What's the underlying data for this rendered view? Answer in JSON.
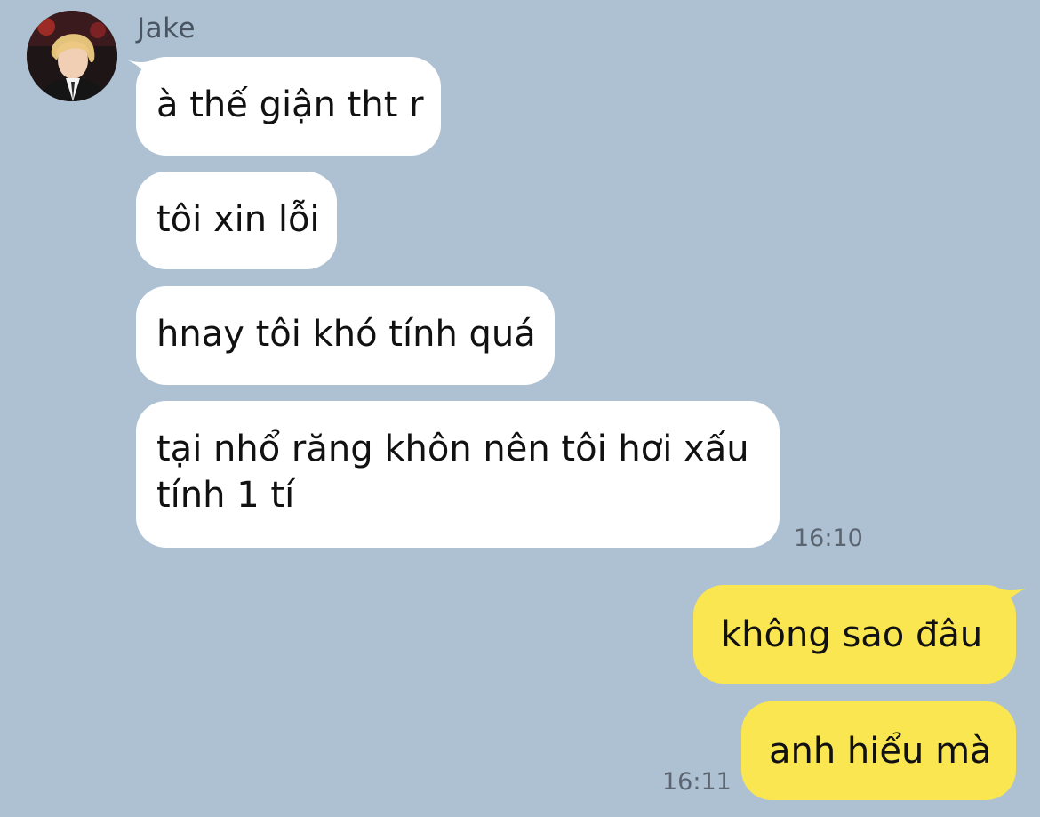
{
  "chat": {
    "sender": {
      "name": "Jake"
    },
    "incoming": [
      {
        "text": "à thế giận tht r"
      },
      {
        "text": "tôi xin lỗi"
      },
      {
        "text": "hnay tôi khó tính quá"
      },
      {
        "text": "tại nhổ răng khôn nên tôi hơi xấu tính 1 tí"
      }
    ],
    "incoming_time": "16:10",
    "outgoing": [
      {
        "text": "không sao đâu"
      },
      {
        "text": "anh hiểu mà"
      }
    ],
    "outgoing_time": "16:11"
  },
  "colors": {
    "background": "#adc1d2",
    "incoming_bubble": "#ffffff",
    "outgoing_bubble": "#fae650"
  },
  "icons": {
    "avatar": "profile-photo"
  }
}
